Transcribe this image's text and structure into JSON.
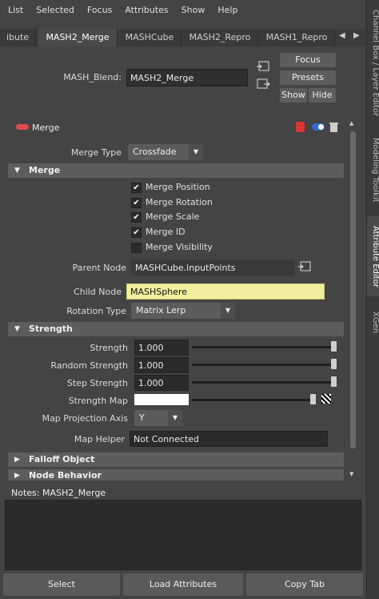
{
  "menu": [
    "List",
    "Selected",
    "Focus",
    "Attributes",
    "Show",
    "Help"
  ],
  "tabs": [
    "ibute",
    "MASH2_Merge",
    "MASHCube",
    "MASH2_Repro",
    "MASH1_Repro"
  ],
  "header": {
    "blend_label": "MASH_Blend:",
    "blend_value": "MASH2_Merge",
    "focus": "Focus",
    "presets": "Presets",
    "show": "Show",
    "hide": "Hide"
  },
  "side_tabs": [
    "Channel Box / Layer Editor",
    "Modeling Toolkit",
    "Attribute Editor",
    "XGen"
  ],
  "node": {
    "title": "Merge",
    "merge_type_label": "Merge Type",
    "merge_type_value": "Crossfade"
  },
  "merge_section": {
    "title": "Merge",
    "checks": [
      {
        "label": "Merge Position",
        "checked": true
      },
      {
        "label": "Merge Rotation",
        "checked": true
      },
      {
        "label": "Merge Scale",
        "checked": true
      },
      {
        "label": "Merge ID",
        "checked": true
      },
      {
        "label": "Merge Visibility",
        "checked": false
      }
    ],
    "parent_node_label": "Parent Node",
    "parent_node_value": "MASHCube.inputPoints",
    "child_node_label": "Child Node",
    "child_node_value": "MASHSphere",
    "rotation_type_label": "Rotation Type",
    "rotation_type_value": "Matrix Lerp"
  },
  "strength_section": {
    "title": "Strength",
    "strength_label": "Strength",
    "strength_value": "1.000",
    "strength_level": 1.0,
    "random_label": "Random Strength",
    "random_value": "1.000",
    "random_level": 1.0,
    "step_label": "Step Strength",
    "step_value": "1.000",
    "step_level": 1.0,
    "map_label": "Strength Map",
    "map_axis_label": "Map Projection Axis",
    "map_axis_value": "Y",
    "helper_label": "Map Helper",
    "helper_value": "Not Connected"
  },
  "collapsed_sections": [
    "Falloff Object",
    "Node Behavior"
  ],
  "notes_label": "Notes:  MASH2_Merge",
  "bottom_buttons": {
    "select": "Select",
    "load": "Load Attributes",
    "copy": "Copy Tab"
  }
}
